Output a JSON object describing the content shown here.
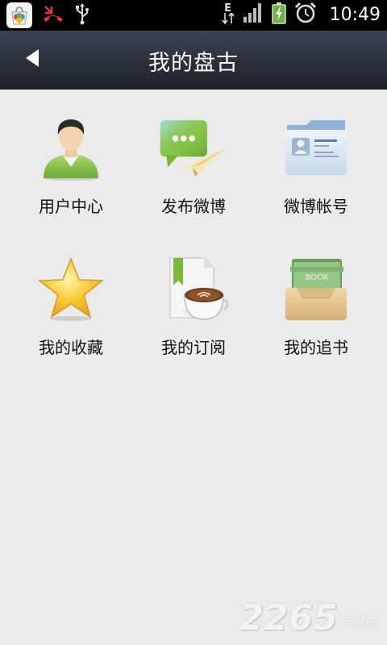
{
  "status_bar": {
    "time": "10:49",
    "network_letter": "E",
    "icons": [
      "app-notification-icon",
      "missed-call-icon",
      "usb-icon",
      "network-e-icon",
      "signal-icon",
      "battery-charging-icon",
      "alarm-icon"
    ]
  },
  "header": {
    "title": "我的盘古",
    "back_icon": "back-arrow-icon"
  },
  "grid": {
    "items": [
      {
        "label": "用户中心",
        "icon": "user-center-icon"
      },
      {
        "label": "发布微博",
        "icon": "post-weibo-icon"
      },
      {
        "label": "微博帐号",
        "icon": "weibo-account-icon"
      },
      {
        "label": "我的收藏",
        "icon": "favorites-star-icon"
      },
      {
        "label": "我的订阅",
        "icon": "subscriptions-icon"
      },
      {
        "label": "我的追书",
        "icon": "book-tracking-icon"
      }
    ]
  },
  "watermark": {
    "number": "2265",
    "suffix": "手游网"
  },
  "colors": {
    "titlebar_top": "#3b4452",
    "titlebar_bottom": "#1d2129",
    "background": "#ebebeb"
  }
}
